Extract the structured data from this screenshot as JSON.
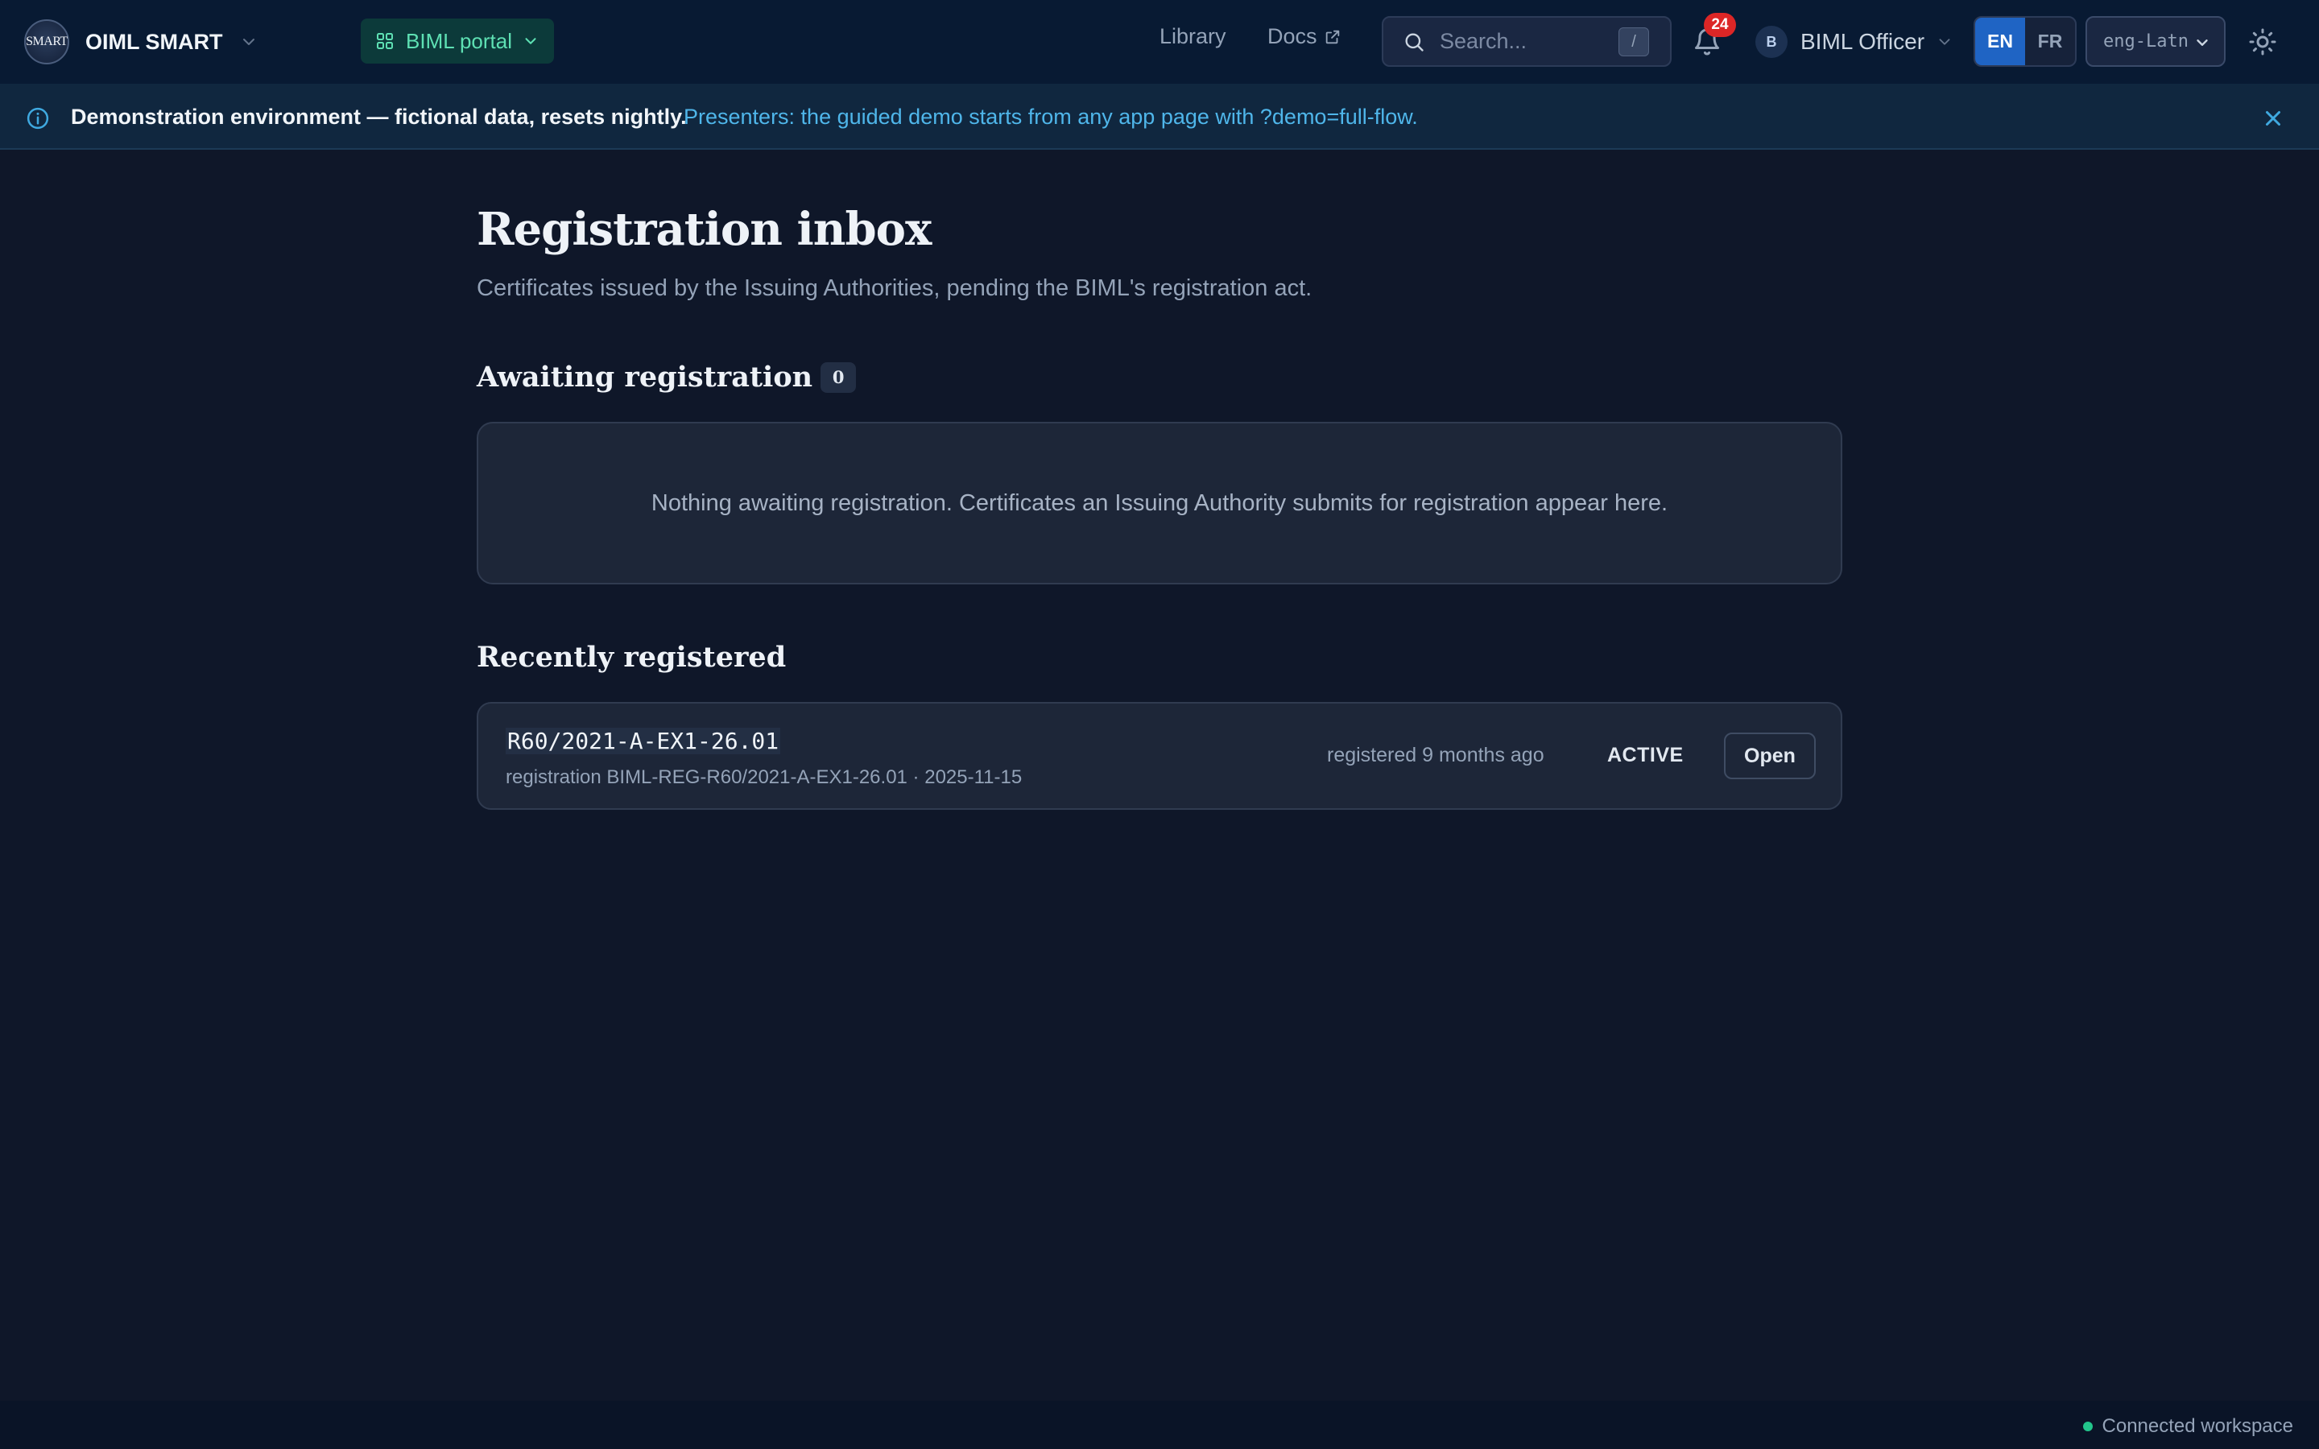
{
  "header": {
    "brand_logo_text": "SMART",
    "brand_name": "OIML SMART",
    "portal_label": "BIML portal",
    "nav": {
      "library": "Library",
      "docs": "Docs"
    },
    "search": {
      "placeholder": "Search...",
      "shortcut": "/"
    },
    "notifications_count": "24",
    "user": {
      "initial": "B",
      "name": "BIML Officer"
    },
    "languages": [
      "EN",
      "FR"
    ],
    "active_language": "EN",
    "script_select_value": "eng-Latn"
  },
  "banner": {
    "strong_text": "Demonstration environment — fictional data, resets nightly.",
    "link_text": "Presenters: the guided demo starts from any app page with ?demo=full-flow."
  },
  "page": {
    "title": "Registration inbox",
    "subtitle": "Certificates issued by the Issuing Authorities, pending the BIML's registration act."
  },
  "awaiting": {
    "title": "Awaiting registration",
    "count": "0",
    "empty_message": "Nothing awaiting registration. Certificates an Issuing Authority submits for registration appear here."
  },
  "recent": {
    "title": "Recently registered",
    "items": [
      {
        "id": "R60/2021-A-EX1-26.01",
        "meta": "registration BIML-REG-R60/2021-A-EX1-26.01 · 2025-11-15",
        "time": "registered 9 months ago",
        "status": "ACTIVE",
        "action": "Open"
      }
    ]
  },
  "footer": {
    "status_text": "Connected workspace"
  },
  "colors": {
    "background": "#0f1729",
    "topbar": "#081a33",
    "accent_green": "#5ee0b3",
    "accent_blue": "#1f64c4",
    "link_blue": "#4fb6ea",
    "badge_red": "#dc2626",
    "status_green": "#22c58b"
  },
  "icons": {
    "portal": "grid-icon",
    "docs": "external-link-icon",
    "search": "search-icon",
    "notifications": "bell-icon",
    "banner": "info-icon",
    "banner_close": "close-icon",
    "theme": "sun-icon"
  }
}
